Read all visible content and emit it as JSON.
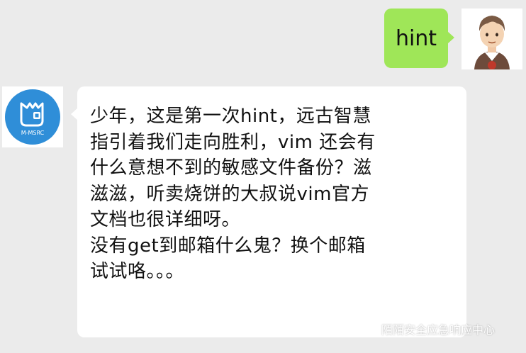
{
  "messages": [
    {
      "side": "right",
      "text": "hint"
    },
    {
      "side": "left",
      "lines": [
        "少年，这是第一次hint，远古智慧",
        "指引着我们走向胜利，vim 还会有",
        "什么意想不到的敏感文件备份？滋",
        "滋滋，听卖烧饼的大叔说vim官方",
        "文档也很详细呀。",
        "没有get到邮箱什么鬼？换个邮箱",
        "试试咯。。。"
      ]
    }
  ],
  "bot_avatar": {
    "logo_text": "M-MSRC",
    "color": "#2f8ed8"
  },
  "watermark": {
    "text": "陌陌安全应急响应中心"
  },
  "colors": {
    "background": "#ebebeb",
    "outgoing_bubble": "#9fe658",
    "incoming_bubble": "#ffffff"
  }
}
